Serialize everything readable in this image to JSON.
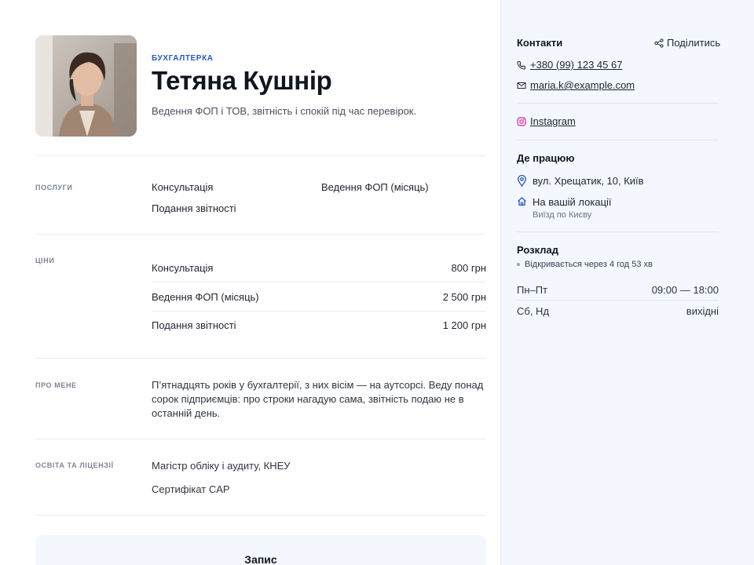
{
  "profile": {
    "category": "БУХГАЛТЕРКА",
    "name": "Тетяна Кушнір",
    "tagline": "Ведення ФОП і ТОВ, звітність і спокій під час перевірок."
  },
  "sections": {
    "services_label": "ПОСЛУГИ",
    "prices_label": "ЦІНИ",
    "about_label": "ПРО МЕНЕ",
    "education_label": "ОСВІТА ТА ЛІЦЕНЗІЇ"
  },
  "services": [
    "Консультація",
    "Ведення ФОП (місяць)",
    "Подання звітності"
  ],
  "prices": [
    {
      "name": "Консультація",
      "price": "800 грн"
    },
    {
      "name": "Ведення ФОП (місяць)",
      "price": "2 500 грн"
    },
    {
      "name": "Подання звітності",
      "price": "1 200 грн"
    }
  ],
  "about": "П’ятнадцять років у бухгалтерії, з них вісім — на аутсорсі. Веду понад сорок підприємців: про строки нагадую сама, звітність подаю не в останній день.",
  "education": [
    "Магістр обліку і аудиту, КНЕУ",
    "Сертифікат CAP"
  ],
  "booking": {
    "title": "Запис"
  },
  "sidebar": {
    "contacts_title": "Контакти",
    "share_label": "Поділитись",
    "phone": "+380 (99) 123 45 67",
    "email": "maria.k@example.com",
    "instagram": "Instagram",
    "workplace_title": "Де працюю",
    "address": "вул. Хрещатик, 10, Київ",
    "onsite_title": "На вашій локації",
    "onsite_sub": "Виїзд по Києву",
    "schedule_title": "Розклад",
    "status": "Відкривається через 4 год 53 хв",
    "schedule": [
      {
        "days": "Пн–Пт",
        "hours": "09:00 — 18:00"
      },
      {
        "days": "Сб, Нд",
        "hours": "вихідні"
      }
    ]
  },
  "colors": {
    "accent": "#2459c8",
    "sidebar_bg": "#f4f7fd",
    "instagram": "#d6249f"
  }
}
